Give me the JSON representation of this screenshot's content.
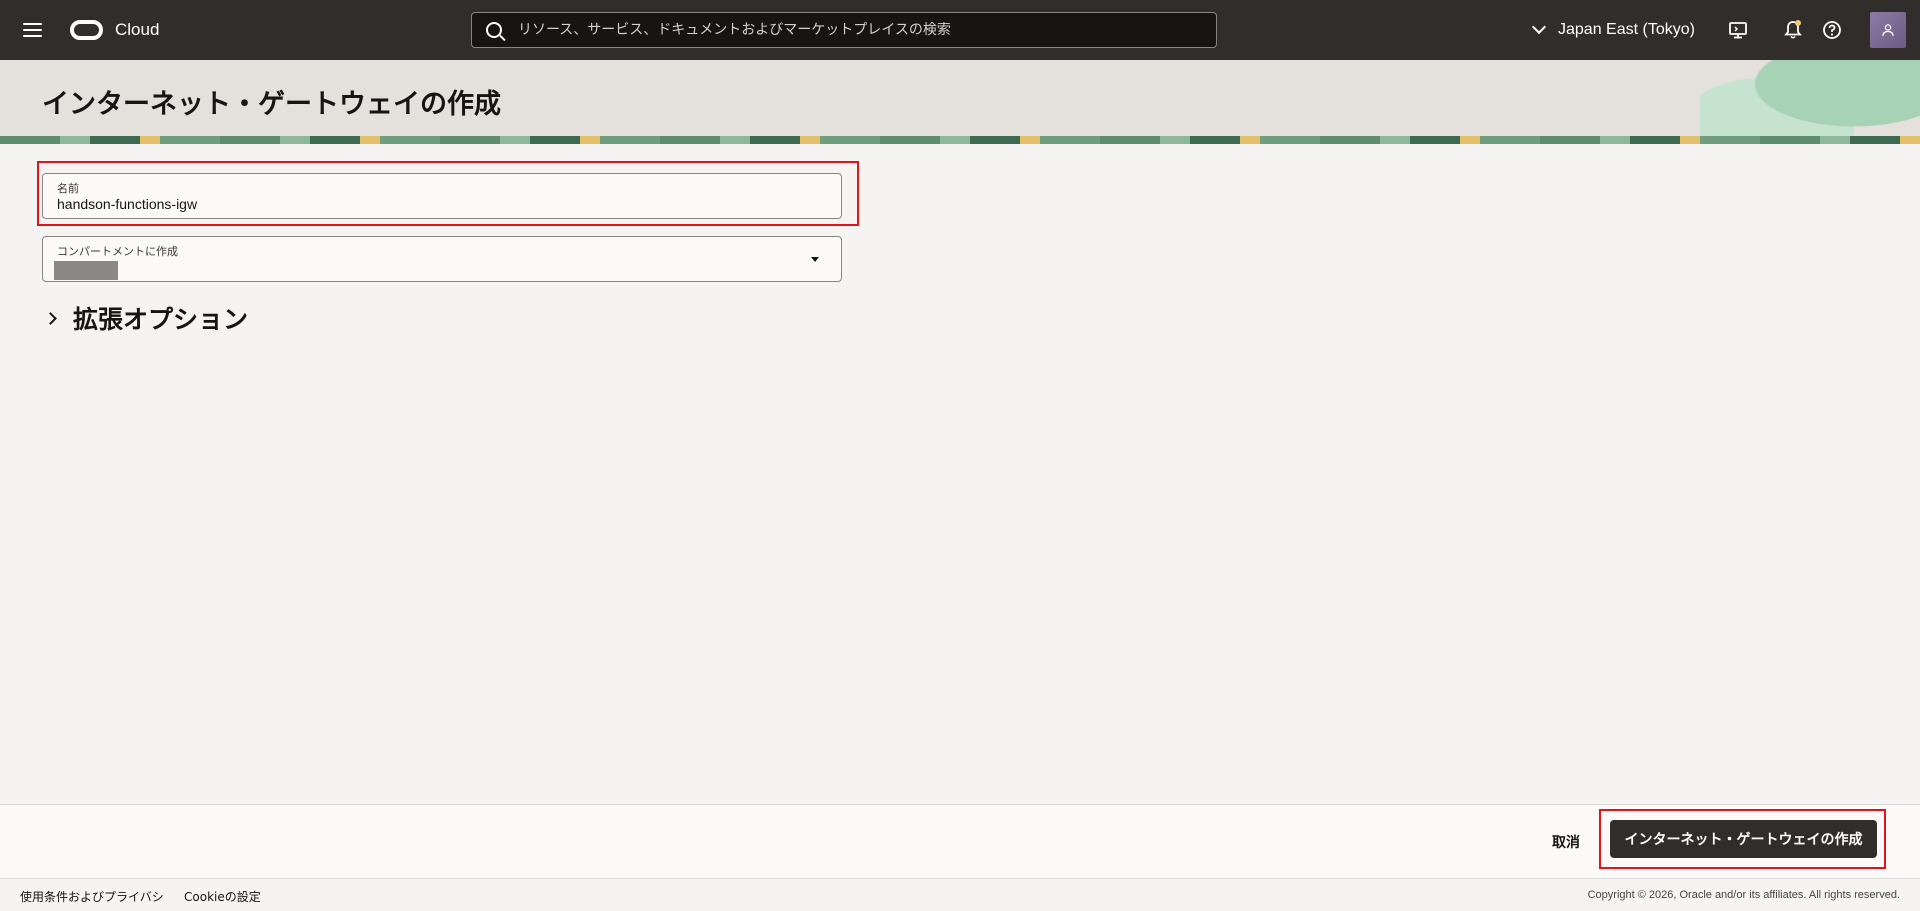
{
  "topbar": {
    "brand": "Cloud",
    "search_placeholder": "リソース、サービス、ドキュメントおよびマーケットプレイスの検索",
    "region": "Japan East (Tokyo)"
  },
  "header": {
    "title": "インターネット・ゲートウェイの作成"
  },
  "form": {
    "name_label": "名前",
    "name_value": "handson-functions-igw",
    "compartment_label": "コンパートメントに作成",
    "advanced_options_label": "拡張オプション"
  },
  "actions": {
    "cancel": "取消",
    "create": "インターネット・ゲートウェイの作成"
  },
  "footer": {
    "terms": "使用条件およびプライバシ",
    "cookies": "Cookieの設定",
    "copyright": "Copyright © 2026, Oracle and/or its affiliates. All rights reserved."
  },
  "colors": {
    "topbar": "#312d2a",
    "highlight": "#e3131b",
    "primary_button": "#312d2a"
  }
}
